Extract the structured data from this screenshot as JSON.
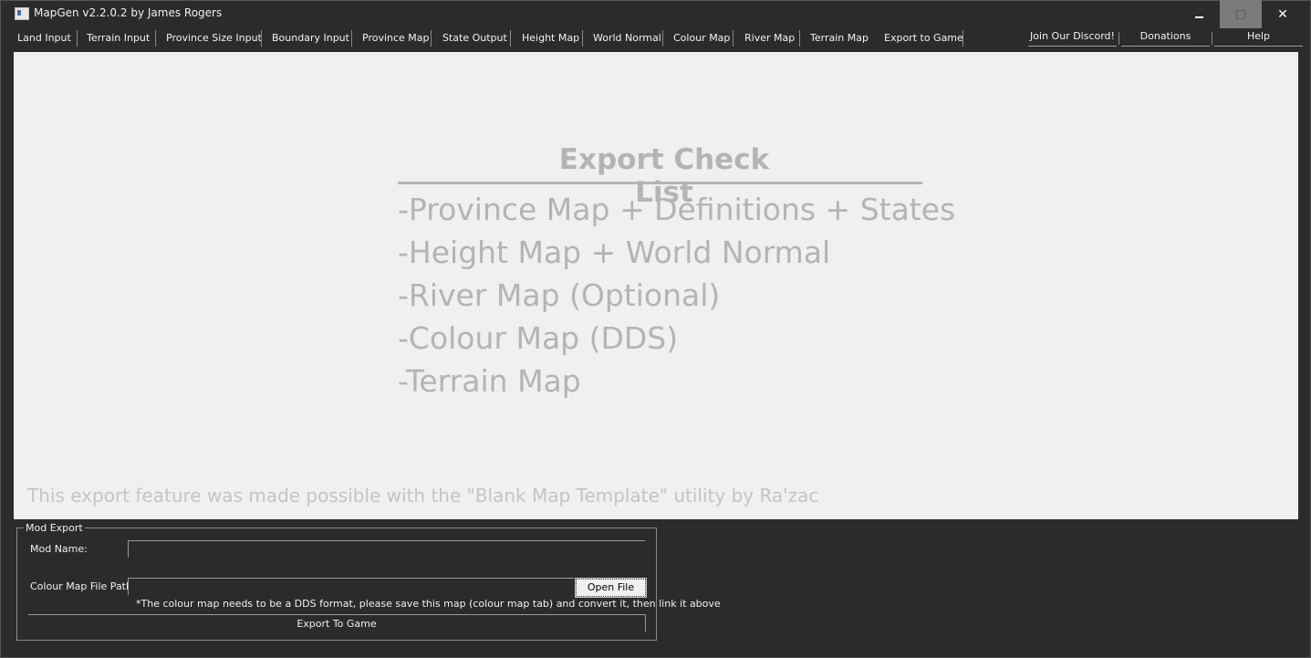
{
  "window": {
    "title": "MapGen v2.2.0.2 by James Rogers",
    "controls": {
      "minimize": "",
      "maximize": "",
      "close": "✕"
    }
  },
  "menu": {
    "tabs": [
      "Land Input",
      "Terrain Input",
      "Province Size Input",
      "Boundary Input",
      "Province Map",
      "State Output",
      "Height Map",
      "World Normal",
      "Colour Map",
      "River Map",
      "Terrain Map",
      "Export to Game"
    ],
    "right_buttons": [
      "Join Our Discord!",
      "Donations",
      "Help"
    ]
  },
  "checklist": {
    "title": "Export Check List",
    "items": [
      "-Province Map + Definitions + States",
      "-Height Map + World Normal",
      "-River Map (Optional)",
      "-Colour Map (DDS)",
      "-Terrain Map"
    ],
    "credit": "This export feature was made possible with the \"Blank Map Template\" utility by Ra'zac"
  },
  "mod_export": {
    "group_title": "Mod Export",
    "mod_name_label": "Mod Name:",
    "mod_name_value": "",
    "colour_path_label": "Colour Map File Path:",
    "colour_path_value": "",
    "open_file_label": "Open File",
    "note": "*The colour map needs to be a DDS format, please save this map (colour map tab) and convert it, then link it above",
    "export_label": "Export To Game"
  },
  "colors": {
    "background": "#2b2b2b",
    "panel": "#f0f0f0",
    "checklist_text": "#b4b4b4"
  }
}
